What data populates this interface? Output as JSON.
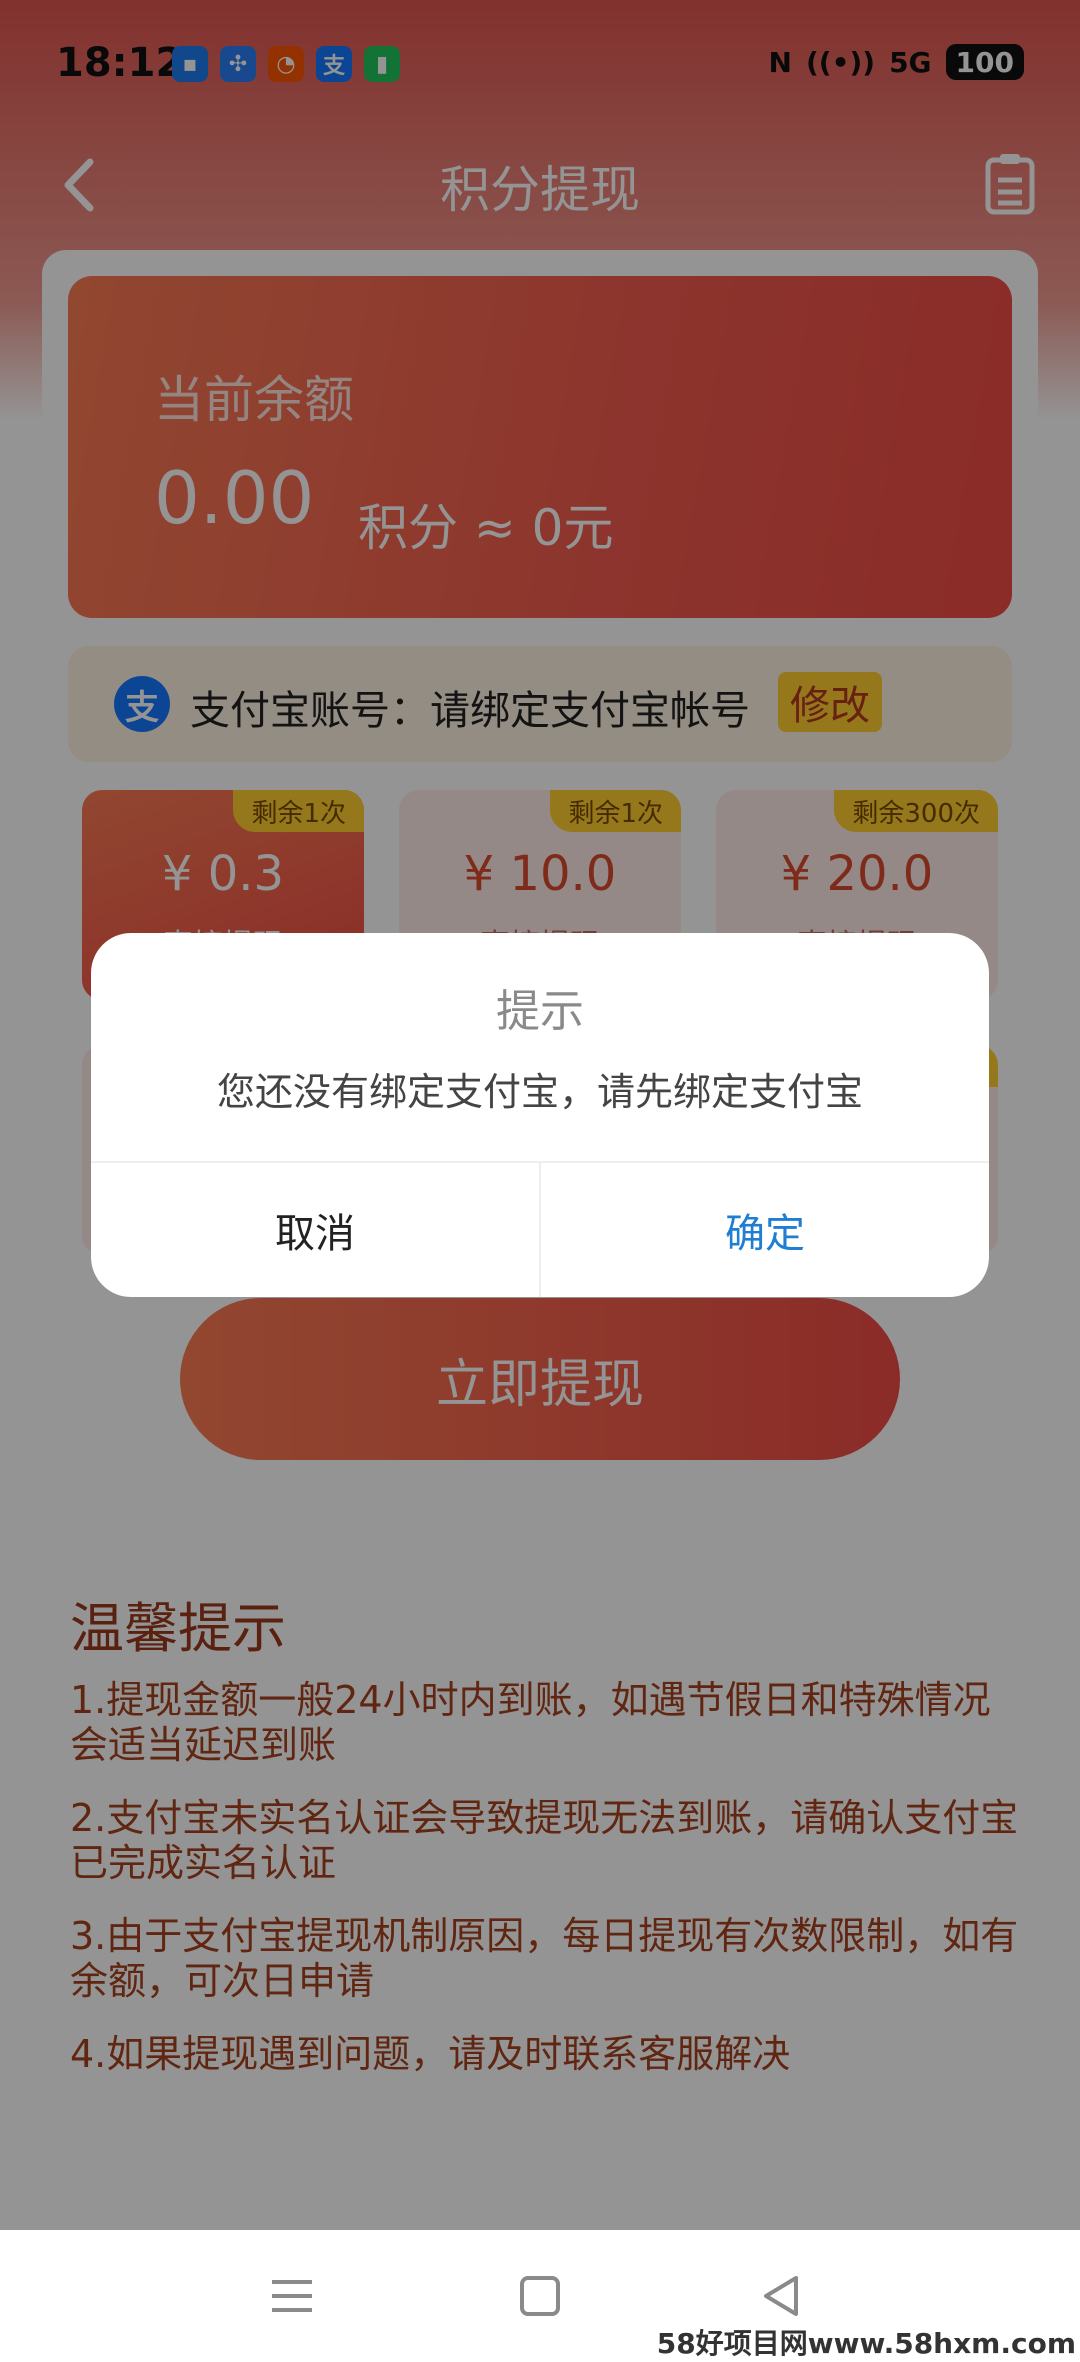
{
  "status_bar": {
    "time": "18:12",
    "apps": [
      {
        "icon": "message-icon",
        "glyph": "▪",
        "color": "#1e7bf0"
      },
      {
        "icon": "fan-icon",
        "glyph": "✣",
        "color": "#2a7ef6"
      },
      {
        "icon": "taobao-icon",
        "glyph": "◔",
        "color": "#ff5500"
      },
      {
        "icon": "alipay-icon",
        "glyph": "支",
        "color": "#1677ff"
      },
      {
        "icon": "battery-app-icon",
        "glyph": "▮",
        "color": "#21c45d"
      }
    ],
    "nfc": "N",
    "wifi": "((•))",
    "signal": "5G",
    "battery": "100"
  },
  "header": {
    "title": "积分提现"
  },
  "balance": {
    "label": "当前余额",
    "amount": "0.00",
    "unit_text": "积分 ≈ 0元"
  },
  "account": {
    "logo": "支",
    "text": "支付宝账号：请绑定支付宝帐号",
    "modify_label": "修改"
  },
  "options": [
    {
      "tag": "剩余1次",
      "price": "¥ 0.3",
      "sub": "直接提现"
    },
    {
      "tag": "剩余1次",
      "price": "¥ 10.0",
      "sub": "直接提现"
    },
    {
      "tag": "剩余300次",
      "price": "¥ 20.0",
      "sub": "直接提现"
    }
  ],
  "withdraw_button": "立即提现",
  "tips": {
    "title": "温馨提示",
    "items": [
      "1.提现金额一般24小时内到账，如遇节假日和特殊情况会适当延迟到账",
      "2.支付宝未实名认证会导致提现无法到账，请确认支付宝已完成实名认证",
      "3.由于支付宝提现机制原因，每日提现有次数限制，如有余额，可次日申请",
      "4.如果提现遇到问题，请及时联系客服解决"
    ]
  },
  "dialog": {
    "title": "提示",
    "message": "您还没有绑定支付宝，请先绑定支付宝",
    "cancel": "取消",
    "confirm": "确定"
  },
  "watermark": "58好项目网www.58hxm.com"
}
